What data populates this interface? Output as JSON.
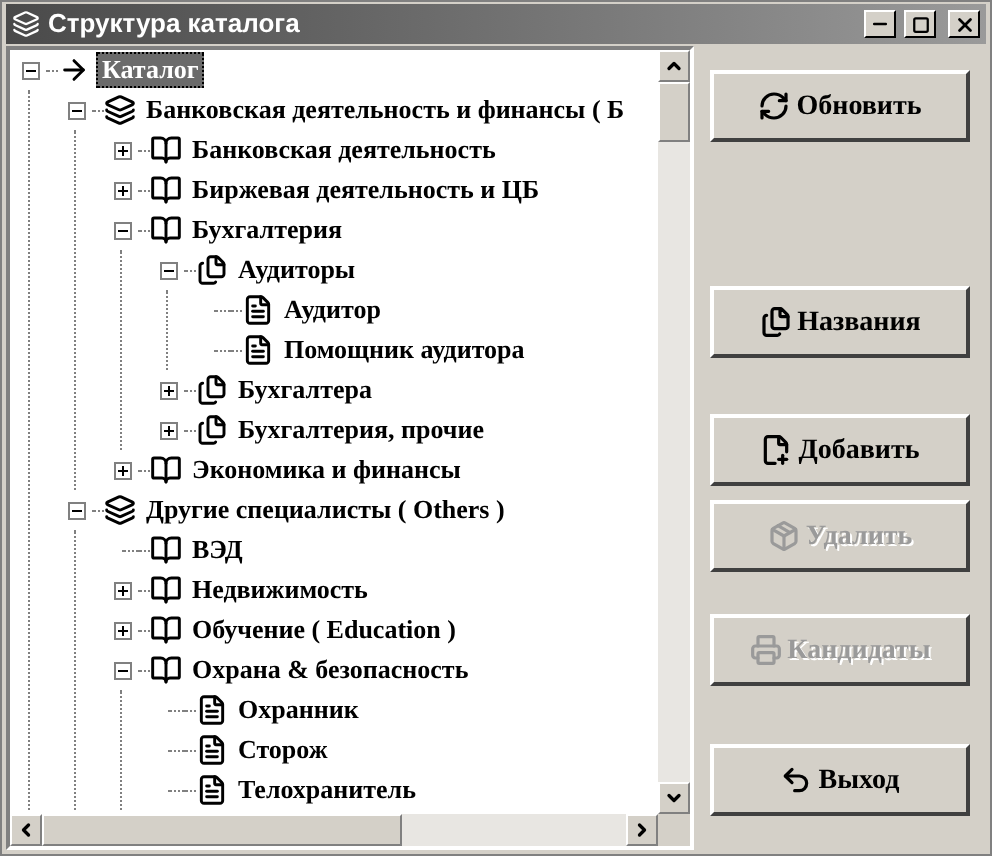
{
  "window": {
    "title": "Структура каталога"
  },
  "tree": [
    {
      "label": "Каталог",
      "kind": "arrow",
      "expanded": true,
      "selected": true,
      "children": [
        {
          "label": "Банковская деятельность и финансы ( Б",
          "kind": "stack",
          "expanded": true,
          "selected": false,
          "children": [
            {
              "label": "Банковская деятельность",
              "kind": "book",
              "expanded": false,
              "selected": false
            },
            {
              "label": "Биржевая деятельность и ЦБ",
              "kind": "book",
              "expanded": false,
              "selected": false
            },
            {
              "label": "Бухгалтерия",
              "kind": "book",
              "expanded": true,
              "selected": false,
              "children": [
                {
                  "label": "Аудиторы",
                  "kind": "docs",
                  "expanded": true,
                  "selected": false,
                  "children": [
                    {
                      "label": "Аудитор",
                      "kind": "doc",
                      "selected": false
                    },
                    {
                      "label": "Помощник аудитора",
                      "kind": "doc",
                      "selected": false
                    }
                  ]
                },
                {
                  "label": "Бухгалтера",
                  "kind": "docs",
                  "expanded": false,
                  "selected": false
                },
                {
                  "label": "Бухгалтерия, прочие",
                  "kind": "docs",
                  "expanded": false,
                  "selected": false
                }
              ]
            },
            {
              "label": "Экономика и финансы",
              "kind": "book",
              "expanded": false,
              "selected": false
            }
          ]
        },
        {
          "label": "Другие специалисты ( Others )",
          "kind": "stack",
          "expanded": true,
          "selected": false,
          "children": [
            {
              "label": "ВЭД",
              "kind": "book",
              "selected": false
            },
            {
              "label": "Недвижимость",
              "kind": "book",
              "expanded": false,
              "selected": false
            },
            {
              "label": "Обучение ( Education )",
              "kind": "book",
              "expanded": false,
              "selected": false
            },
            {
              "label": "Охрана & безопасность",
              "kind": "book",
              "expanded": true,
              "selected": false,
              "children": [
                {
                  "label": "Охранник",
                  "kind": "doc",
                  "selected": false
                },
                {
                  "label": "Сторож",
                  "kind": "doc",
                  "selected": false
                },
                {
                  "label": "Телохранитель",
                  "kind": "doc",
                  "selected": false
                }
              ]
            }
          ]
        }
      ]
    }
  ],
  "buttons": [
    {
      "label": "Обновить",
      "kind": "refresh",
      "disabled": false
    },
    {
      "label": "Названия",
      "kind": "docs",
      "disabled": false
    },
    {
      "label": "Добавить",
      "kind": "add",
      "disabled": false
    },
    {
      "label": "Удалить",
      "kind": "delete",
      "disabled": true
    },
    {
      "label": "Кандидаты",
      "kind": "print",
      "disabled": true
    },
    {
      "label": "Выход",
      "kind": "exit",
      "disabled": false
    }
  ]
}
